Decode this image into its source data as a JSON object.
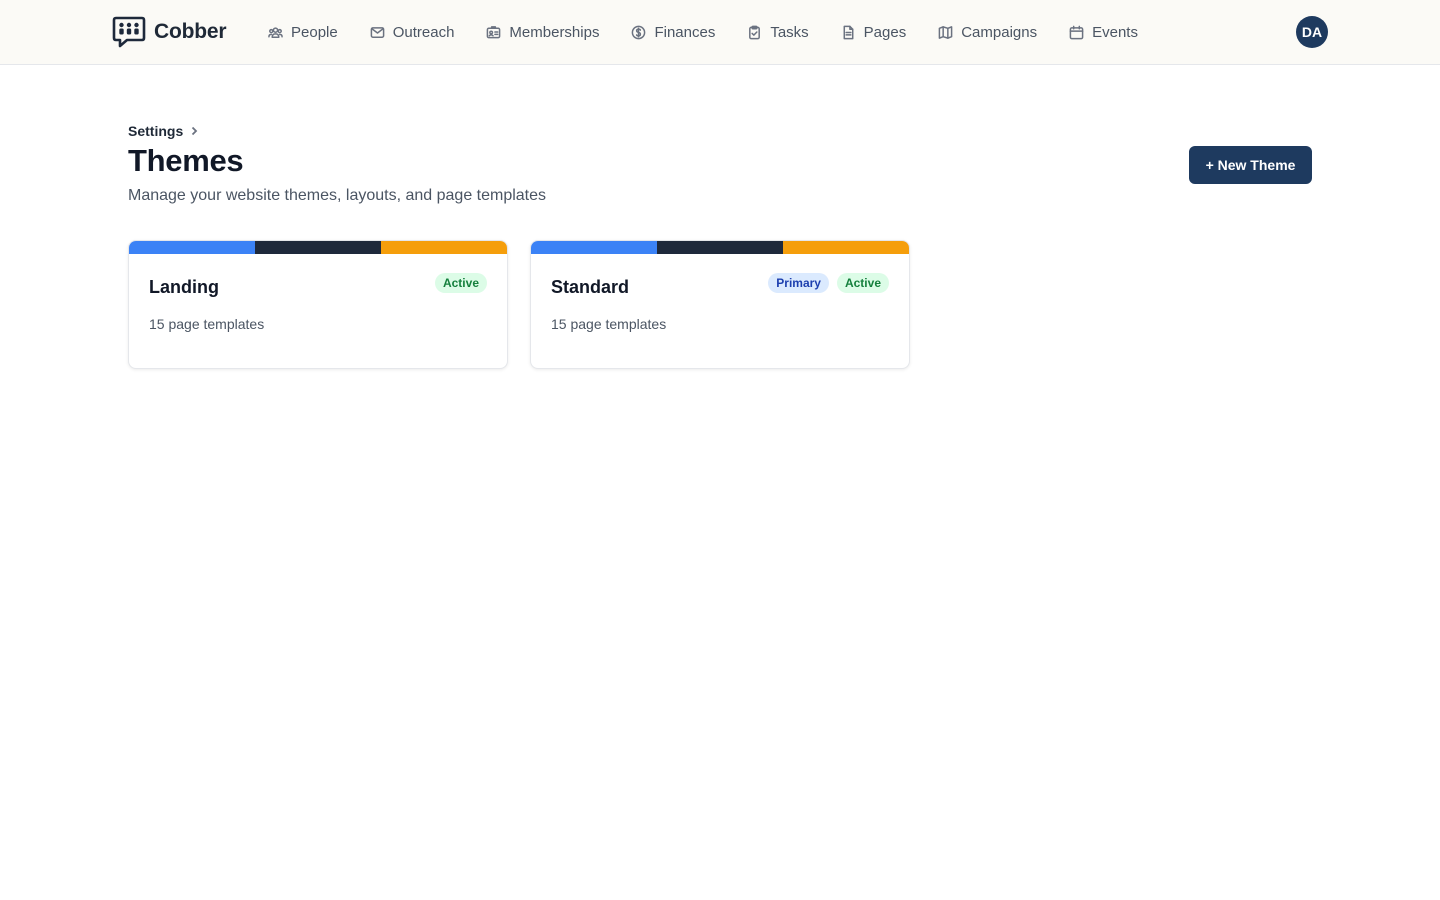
{
  "app": {
    "name": "Cobber",
    "logo_icon": "chat-bubble-people-icon"
  },
  "nav": {
    "items": [
      {
        "label": "People",
        "icon": "people-icon"
      },
      {
        "label": "Outreach",
        "icon": "envelope-icon"
      },
      {
        "label": "Memberships",
        "icon": "id-card-icon"
      },
      {
        "label": "Finances",
        "icon": "dollar-circle-icon"
      },
      {
        "label": "Tasks",
        "icon": "clipboard-check-icon"
      },
      {
        "label": "Pages",
        "icon": "document-icon"
      },
      {
        "label": "Campaigns",
        "icon": "map-icon"
      },
      {
        "label": "Events",
        "icon": "calendar-icon"
      }
    ]
  },
  "user": {
    "initials": "DA"
  },
  "breadcrumb": {
    "parent": "Settings"
  },
  "page": {
    "title": "Themes",
    "subtitle": "Manage your website themes, layouts, and page templates",
    "new_button": "+ New Theme"
  },
  "themes": [
    {
      "name": "Landing",
      "templates": "15 page templates",
      "badges": [
        "Active"
      ],
      "colors": [
        "#3b82f6",
        "#1e293b",
        "#f59e0b"
      ]
    },
    {
      "name": "Standard",
      "templates": "15 page templates",
      "badges": [
        "Primary",
        "Active"
      ],
      "colors": [
        "#3b82f6",
        "#1e293b",
        "#f59e0b"
      ]
    }
  ],
  "colors": {
    "brand": "#1e3a5f",
    "active_badge_bg": "#dcfce7",
    "active_badge_text": "#15803d",
    "primary_badge_bg": "#dbeafe",
    "primary_badge_text": "#1e40af"
  }
}
